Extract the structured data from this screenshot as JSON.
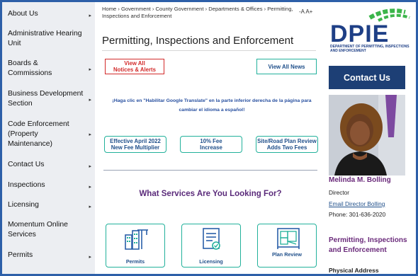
{
  "sidebar": {
    "items": [
      {
        "label": "About Us",
        "has_arrow": true
      },
      {
        "label": "Administrative Hearing Unit",
        "has_arrow": false
      },
      {
        "label": "Boards & Commissions",
        "has_arrow": true
      },
      {
        "label": "Business Development Section",
        "has_arrow": true
      },
      {
        "label": "Code Enforcement (Property Maintenance)",
        "has_arrow": true
      },
      {
        "label": "Contact Us",
        "has_arrow": true
      },
      {
        "label": "Inspections",
        "has_arrow": true
      },
      {
        "label": "Licensing",
        "has_arrow": true
      },
      {
        "label": "Momentum Online Services",
        "has_arrow": false
      },
      {
        "label": "Permits",
        "has_arrow": true
      }
    ],
    "arrow_glyph": "▸"
  },
  "breadcrumb": "Home › Government › County Government › Departments & Offices › Permitting, Inspections and Enforcement",
  "font_controls": "-A A+",
  "page_title": "Permitting, Inspections and Enforcement",
  "buttons": {
    "view_all_notices_line1": "View All",
    "view_all_notices_line2": "Notices & Alerts",
    "view_all_news": "View All News"
  },
  "translate_notice": "¡Haga clic en \"Habilitar Google Translate\" en la parte inferior derecha de la página para cambiar el idioma a español!",
  "notice_buttons": [
    {
      "line1": "Effective April 2022",
      "line2": "New Fee Multiplier"
    },
    {
      "line1": "10% Fee",
      "line2": "Increase"
    },
    {
      "line1": "Site/Road Plan Review",
      "line2": "Adds Two Fees"
    }
  ],
  "services_heading": "What Services Are You Looking For?",
  "services": [
    {
      "label": "Permits",
      "icon": "buildings-crane-icon"
    },
    {
      "label": "Licensing",
      "icon": "certificate-icon"
    },
    {
      "label": "Plan Review",
      "icon": "blueprint-icon"
    }
  ],
  "logo": {
    "letters": "DPIE",
    "caption": "DEPARTMENT OF PERMITTING, INSPECTIONS AND ENFORCEMENT"
  },
  "contact": {
    "button_label": "Contact Us",
    "name": "Melinda M. Bolling",
    "role": "Director",
    "link_text": "Email Director Bolling",
    "phone": "Phone: 301-636-2020",
    "office": "Permitting, Inspections and Enforcement",
    "address_label": "Physical Address"
  },
  "colors": {
    "sidebar_bg": "#eceef2",
    "frame_border": "#2d5fa8",
    "accent_teal": "#22b19b",
    "alert_red": "#d22a2a",
    "navy": "#1d3f75",
    "purple_heading": "#5a2a7a",
    "logo_green": "#3bb54a"
  }
}
